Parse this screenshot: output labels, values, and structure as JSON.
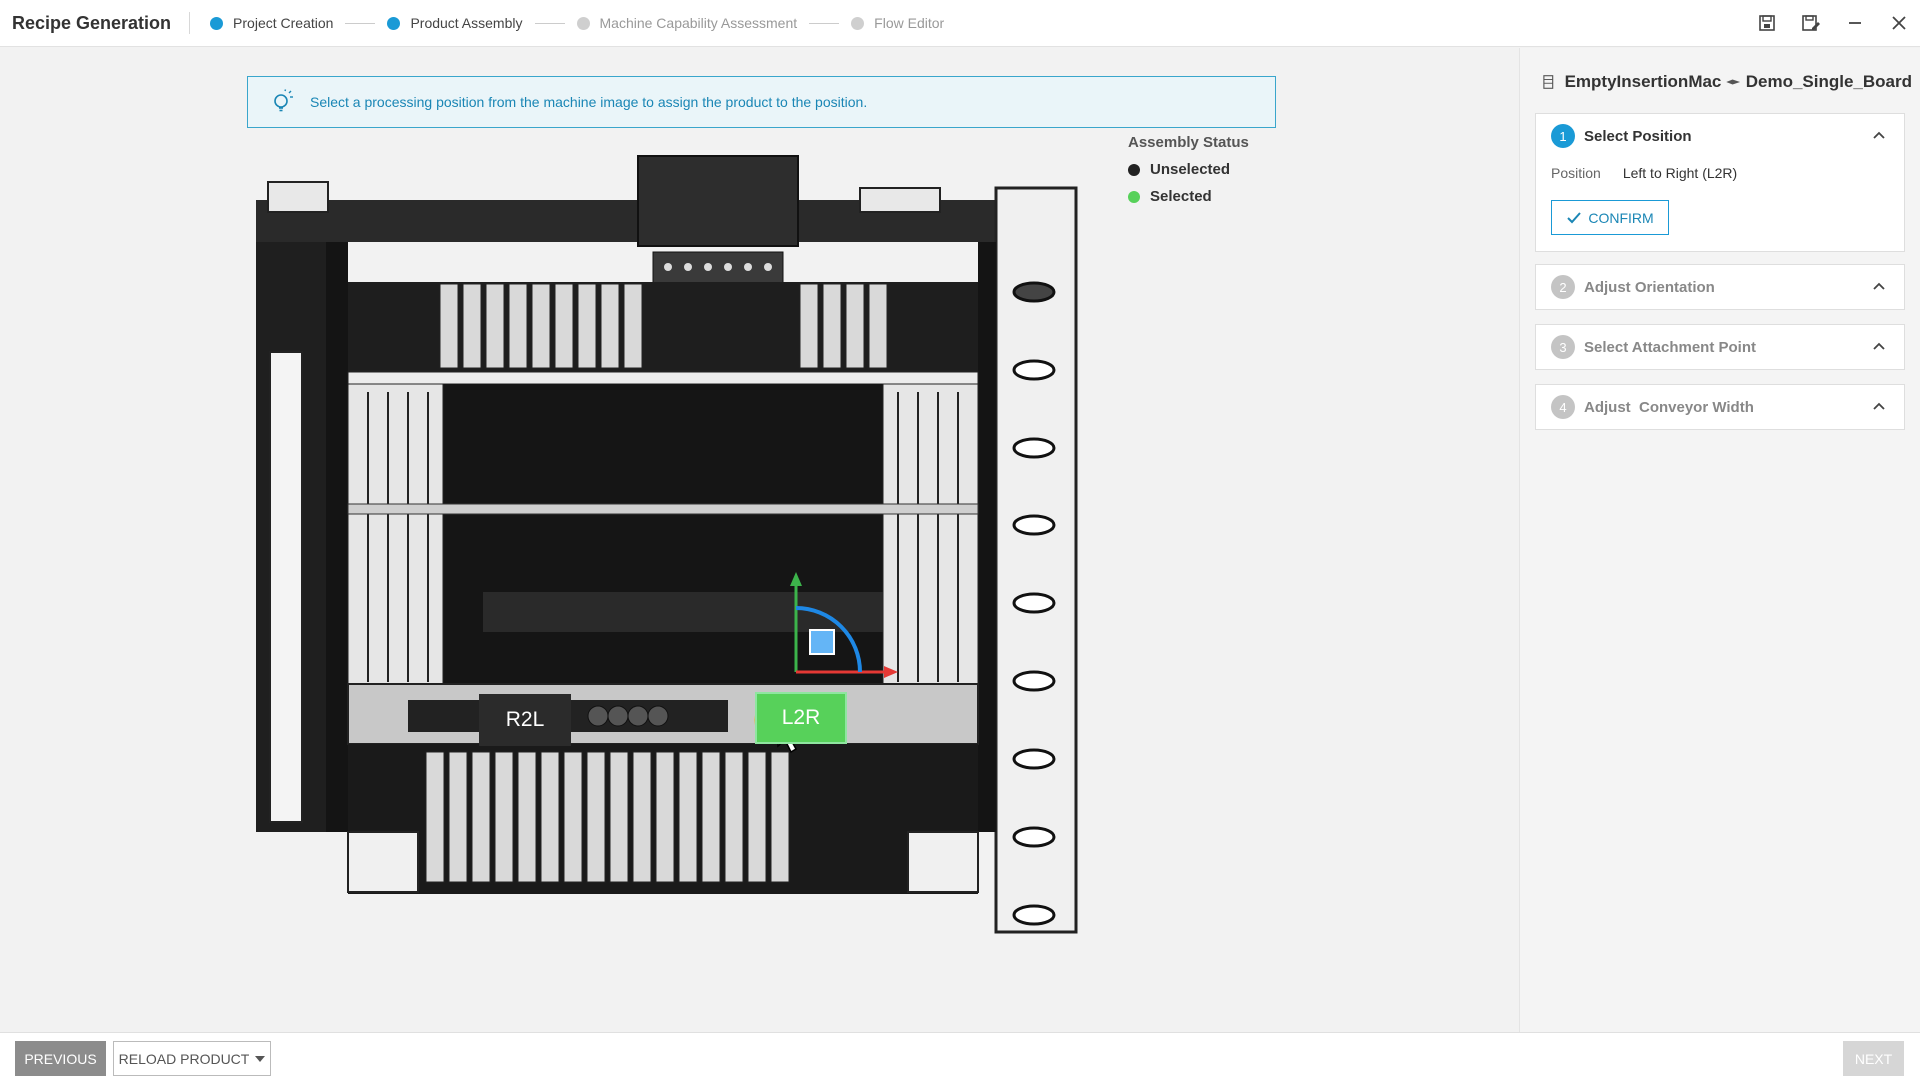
{
  "header": {
    "title": "Recipe Generation",
    "steps": [
      {
        "label": "Project Creation",
        "state": "done"
      },
      {
        "label": "Product Assembly",
        "state": "done"
      },
      {
        "label": "Machine Capability Assessment",
        "state": "todo"
      },
      {
        "label": "Flow Editor",
        "state": "todo"
      }
    ],
    "controls": [
      "save-icon",
      "save-as-icon",
      "minimize-icon",
      "close-icon"
    ]
  },
  "banner": {
    "icon": "lightbulb-icon",
    "text": "Select a processing position from the machine image to assign the product to the position."
  },
  "legend": {
    "title": "Assembly Status",
    "items": [
      {
        "label": "Unselected",
        "color": "#222222"
      },
      {
        "label": "Selected",
        "color": "#57d15a"
      }
    ]
  },
  "machine": {
    "positions": {
      "r2l": "R2L",
      "l2r": "L2R"
    }
  },
  "panel": {
    "machine_name": "EmptyInsertionMac",
    "product_name": "Demo_Single_Board",
    "sections": [
      {
        "number": "1",
        "title": "Select Position",
        "active": true
      },
      {
        "number": "2",
        "title": "Adjust Orientation",
        "active": false
      },
      {
        "number": "3",
        "title": "Select Attachment Point",
        "active": false
      },
      {
        "number": "4",
        "title": "Adjust  Conveyor Width",
        "active": false
      }
    ],
    "position_label": "Position",
    "position_value": "Left to Right (L2R)",
    "confirm_label": "CONFIRM"
  },
  "footer": {
    "previous_label": "PREVIOUS",
    "reload_label": "RELOAD PRODUCT",
    "next_label": "NEXT"
  },
  "colors": {
    "accent": "#1a9ad6",
    "selected": "#57d15a",
    "unselected": "#222222"
  }
}
